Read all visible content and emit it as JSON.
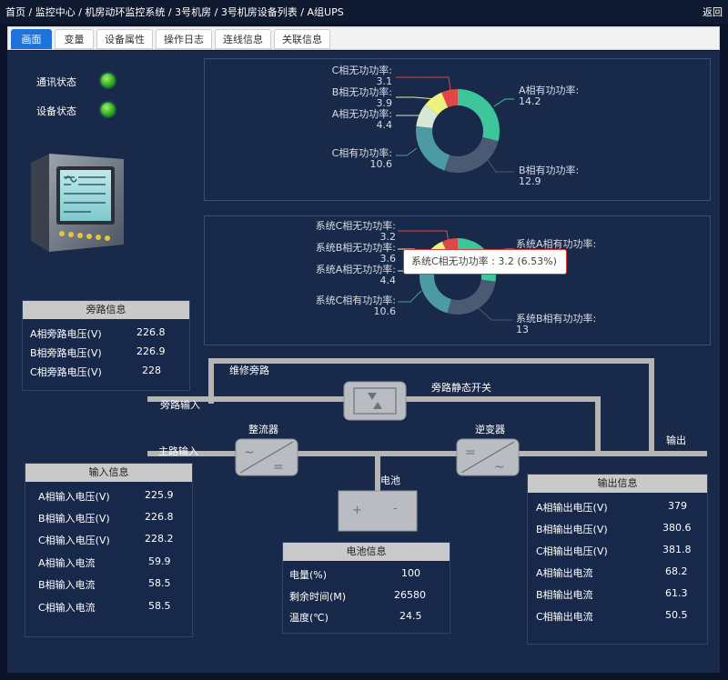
{
  "breadcrumb": [
    "首页",
    "监控中心",
    "机房动环监控系统",
    "3号机房",
    "3号机房设备列表",
    "A组UPS"
  ],
  "back_label": "返回",
  "tabs": [
    {
      "label": "画面",
      "active": true
    },
    {
      "label": "变量",
      "active": false
    },
    {
      "label": "设备属性",
      "active": false
    },
    {
      "label": "操作日志",
      "active": false
    },
    {
      "label": "连线信息",
      "active": false
    },
    {
      "label": "关联信息",
      "active": false
    }
  ],
  "status": {
    "comm_label": "通讯状态",
    "device_label": "设备状态",
    "comm_color": "#36c21f",
    "device_color": "#36c21f"
  },
  "chart_data": [
    {
      "type": "pie",
      "donut": true,
      "labels": [
        "A相有功功率",
        "B相有功功率",
        "C相有功功率",
        "A相无功功率",
        "B相无功功率",
        "C相无功功率"
      ],
      "values": [
        14.2,
        12.9,
        10.6,
        4.4,
        3.9,
        3.1
      ],
      "colors": [
        "#3cc69a",
        "#4a5a72",
        "#4b9aa4",
        "#d6e7d3",
        "#eef07f",
        "#e04848"
      ],
      "label_texts": [
        "A相有功功率:",
        "B相有功功率:",
        "C相有功功率:",
        "A相无功功率:",
        "B相无功功率:",
        "C相无功功率:"
      ]
    },
    {
      "type": "pie",
      "donut": true,
      "labels": [
        "系统A相有功功率",
        "系统B相有功功率",
        "系统C相有功功率",
        "系统A相无功功率",
        "系统B相无功功率",
        "系统C相无功功率"
      ],
      "values": [
        13.0,
        13,
        10.6,
        4.4,
        3.6,
        3.2
      ],
      "colors": [
        "#3cc69a",
        "#4a5a72",
        "#4b9aa4",
        "#d6e7d3",
        "#eef07f",
        "#e04848"
      ],
      "label_texts": [
        "系统A相有功功率:",
        "系统B相有功功率:",
        "系统C相有功功率:",
        "系统A相无功功率:",
        "系统B相无功功率:",
        "系统C相无功功率:"
      ],
      "value_texts": [
        "",
        "13",
        "10.6",
        "4.4",
        "3.6",
        "3.2"
      ]
    }
  ],
  "tooltip": "系统C相无功功率 : 3.2 (6.53%)",
  "bypass_info": {
    "title": "旁路信息",
    "rows": [
      {
        "label": "A相旁路电压(V)",
        "value": "226.8"
      },
      {
        "label": "B相旁路电压(V)",
        "value": "226.9"
      },
      {
        "label": "C相旁路电压(V)",
        "value": "228"
      }
    ]
  },
  "input_info": {
    "title": "输入信息",
    "rows": [
      {
        "label": "A相输入电压(V)",
        "value": "225.9"
      },
      {
        "label": "B相输入电压(V)",
        "value": "226.8"
      },
      {
        "label": "C相输入电压(V)",
        "value": "228.2"
      },
      {
        "label": "A相输入电流",
        "value": "59.9"
      },
      {
        "label": "B相输入电流",
        "value": "58.5"
      },
      {
        "label": "C相输入电流",
        "value": "58.5"
      }
    ]
  },
  "output_info": {
    "title": "输出信息",
    "rows": [
      {
        "label": "A相输出电压(V)",
        "value": "379"
      },
      {
        "label": "B相输出电压(V)",
        "value": "380.6"
      },
      {
        "label": "C相输出电压(V)",
        "value": "381.8"
      },
      {
        "label": "A相输出电流",
        "value": "68.2"
      },
      {
        "label": "B相输出电流",
        "value": "61.3"
      },
      {
        "label": "C相输出电流",
        "value": "50.5"
      }
    ]
  },
  "battery_info": {
    "title": "电池信息",
    "rows": [
      {
        "label": "电量(%)",
        "value": "100"
      },
      {
        "label": "剩余时间(M)",
        "value": "26580"
      },
      {
        "label": "温度(℃)",
        "value": "24.5"
      }
    ]
  },
  "diagram": {
    "maintenance_bypass": "维修旁路",
    "bypass_input": "旁路输入",
    "bypass_static_switch": "旁路静态开关",
    "rectifier": "整流器",
    "inverter": "逆变器",
    "main_input": "主路输入",
    "output": "输出",
    "battery": "电池",
    "battery_plus": "+",
    "battery_minus": "-"
  }
}
